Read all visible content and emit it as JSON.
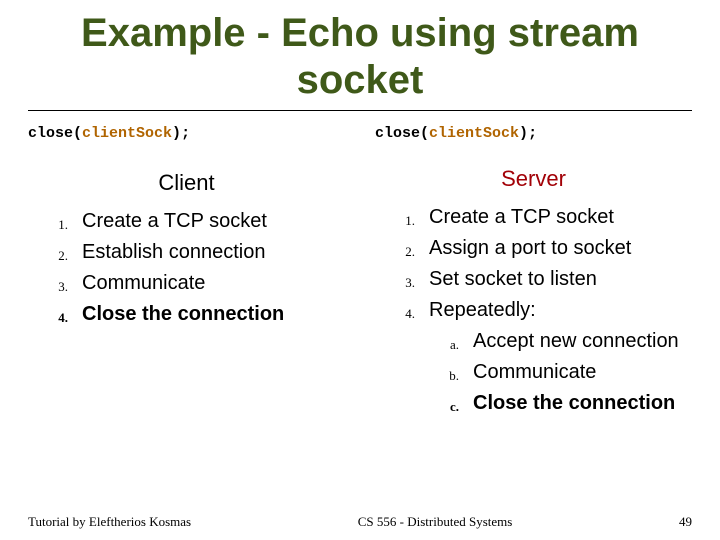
{
  "title_line1": "Example - Echo using stream",
  "title_line2": "socket",
  "left": {
    "code_kw": "close",
    "code_paren_open": "(",
    "code_var": "clientSock",
    "code_paren_close": ")",
    "code_semi": ";",
    "heading": "Client",
    "items": [
      {
        "n": "1.",
        "t": "Create a TCP socket",
        "bold": false
      },
      {
        "n": "2.",
        "t": "Establish connection",
        "bold": false
      },
      {
        "n": "3.",
        "t": "Communicate",
        "bold": false
      },
      {
        "n": "4.",
        "t": "Close the connection",
        "bold": true
      }
    ]
  },
  "right": {
    "code_kw": "close",
    "code_paren_open": "(",
    "code_var": "clientSock",
    "code_paren_close": ")",
    "code_semi": ";",
    "heading": "Server",
    "items": [
      {
        "n": "1.",
        "t": "Create a TCP socket"
      },
      {
        "n": "2.",
        "t": "Assign a port to socket"
      },
      {
        "n": "3.",
        "t": "Set socket to listen"
      },
      {
        "n": "4.",
        "t": "Repeatedly:"
      }
    ],
    "subitems": [
      {
        "n": "a.",
        "t": "Accept new connection",
        "bold": false
      },
      {
        "n": "b.",
        "t": "Communicate",
        "bold": false
      },
      {
        "n": "c.",
        "t": "Close the connection",
        "bold": true
      }
    ]
  },
  "footer": {
    "left": "Tutorial by Eleftherios Kosmas",
    "center": "CS 556 - Distributed Systems",
    "right": "49"
  }
}
